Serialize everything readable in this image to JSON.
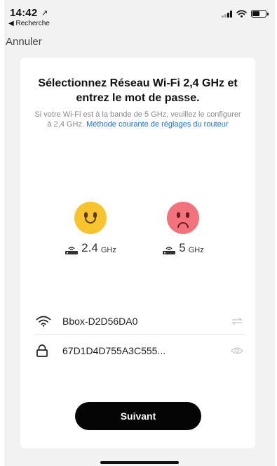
{
  "status_bar": {
    "time": "14:42",
    "back_app": "◀ Recherche",
    "location_arrow": "↗"
  },
  "nav": {
    "cancel_label": "Annuler"
  },
  "card": {
    "title": "Sélectionnez Réseau Wi-Fi 2,4 GHz et entrez le mot de passe.",
    "subtitle_text": "Si votre Wi-Fi est à  la bande de 5 GHz, veuillez le configurer à 2,4 GHz. ",
    "subtitle_link": "Méthode courante de réglages du routeur",
    "bands": [
      {
        "num": "2.4",
        "unit": "GHz",
        "status": "supported",
        "icon": "happy-face-icon"
      },
      {
        "num": "5",
        "unit": "GHz",
        "status": "unsupported",
        "icon": "sad-face-icon"
      }
    ],
    "wifi": {
      "ssid": "Bbox-D2D56DA0",
      "password": "67D1D4D755A3C555..."
    },
    "next_label": "Suivant"
  },
  "colors": {
    "happy": "#f7c32e",
    "sad": "#f2737b",
    "link": "#1a72d6",
    "button": "#050505"
  }
}
